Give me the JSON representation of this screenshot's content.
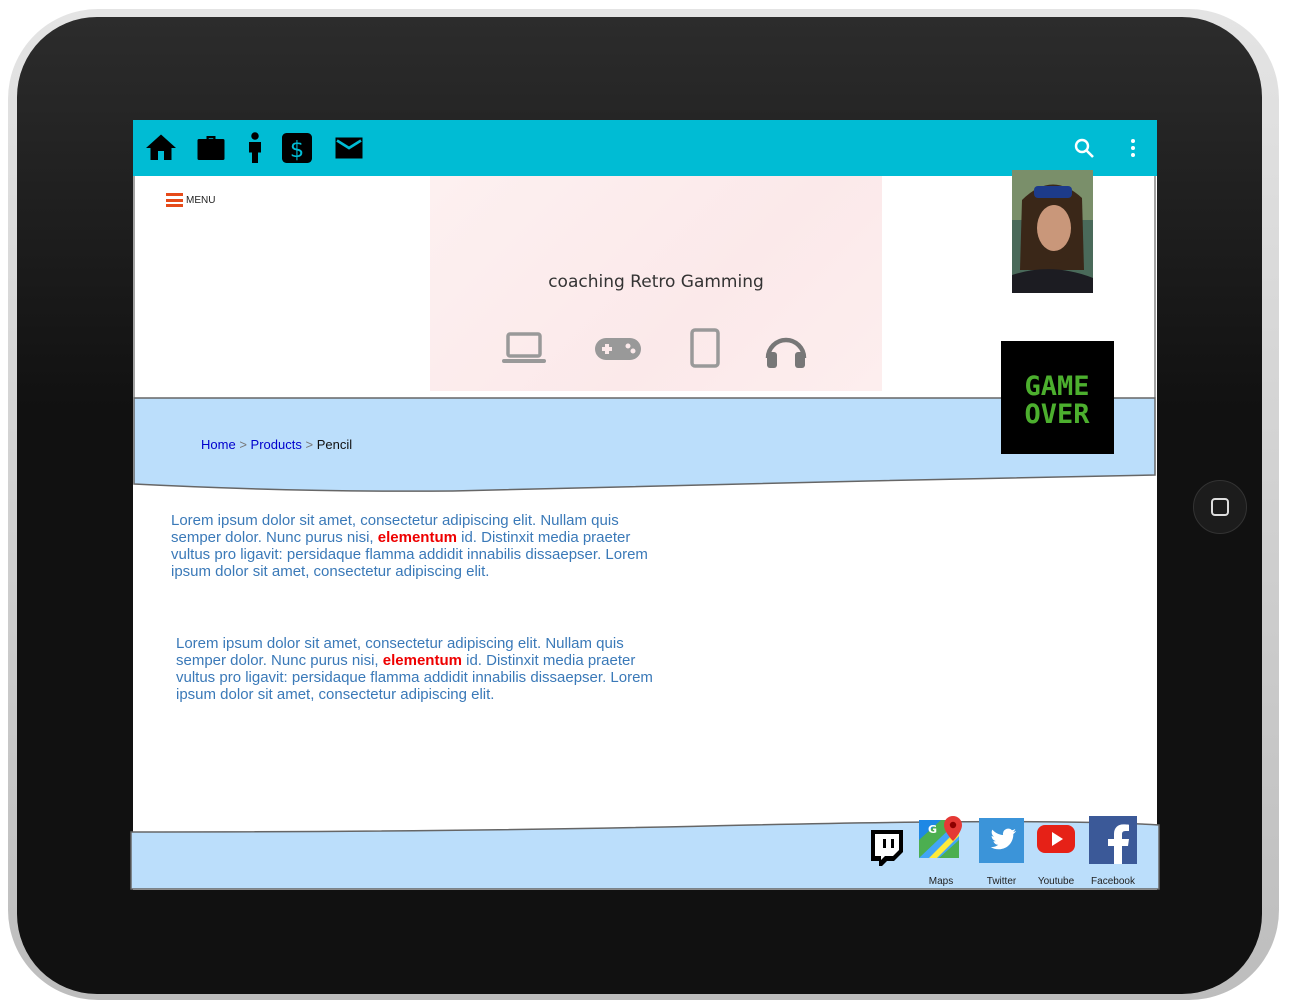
{
  "toolbar": {
    "nav_icons": [
      "home-icon",
      "briefcase-icon",
      "person-icon",
      "dollar-icon",
      "mail-icon"
    ],
    "right_icons": [
      "search-icon",
      "more-vert-icon"
    ]
  },
  "menu": {
    "label": "MENU"
  },
  "banner": {
    "title": "coaching Retro Gamming",
    "icons": [
      "laptop-icon",
      "gamepad-icon",
      "tablet-icon",
      "headphones-icon"
    ]
  },
  "gameover": {
    "line1": "GAME",
    "line2": "OVER"
  },
  "breadcrumb": {
    "items": [
      "Home",
      "Products"
    ],
    "separator": ">",
    "current": "Pencil"
  },
  "paragraphs": [
    {
      "before": "Lorem ipsum dolor sit amet, consectetur adipiscing elit. Nullam quis semper dolor. Nunc purus nisi, ",
      "bold": "elementum",
      "after": " id. Distinxit  media praeter vultus pro ligavit: persidaque flamma addidit innabilis dissaepser. Lorem ipsum dolor sit amet, consectetur adipiscing elit."
    },
    {
      "before": "Lorem ipsum dolor sit amet, consectetur adipiscing elit. Nullam quis semper dolor. Nunc purus nisi, ",
      "bold": "elementum",
      "after": " id. Distinxit  media praeter vultus pro ligavit: persidaque flamma addidit innabilis dissaepser. Lorem ipsum dolor sit amet, consectetur adipiscing elit."
    }
  ],
  "social": {
    "twitch": "",
    "maps": "Maps",
    "twitter": "Twitter",
    "youtube": "Youtube",
    "facebook": "Facebook"
  },
  "colors": {
    "toolbar": "#00bcd4",
    "band": "#bbdefb",
    "link": "#0000cc",
    "text": "#3a79b8",
    "emphasis": "#e00000",
    "menu_accent": "#e64a19"
  }
}
